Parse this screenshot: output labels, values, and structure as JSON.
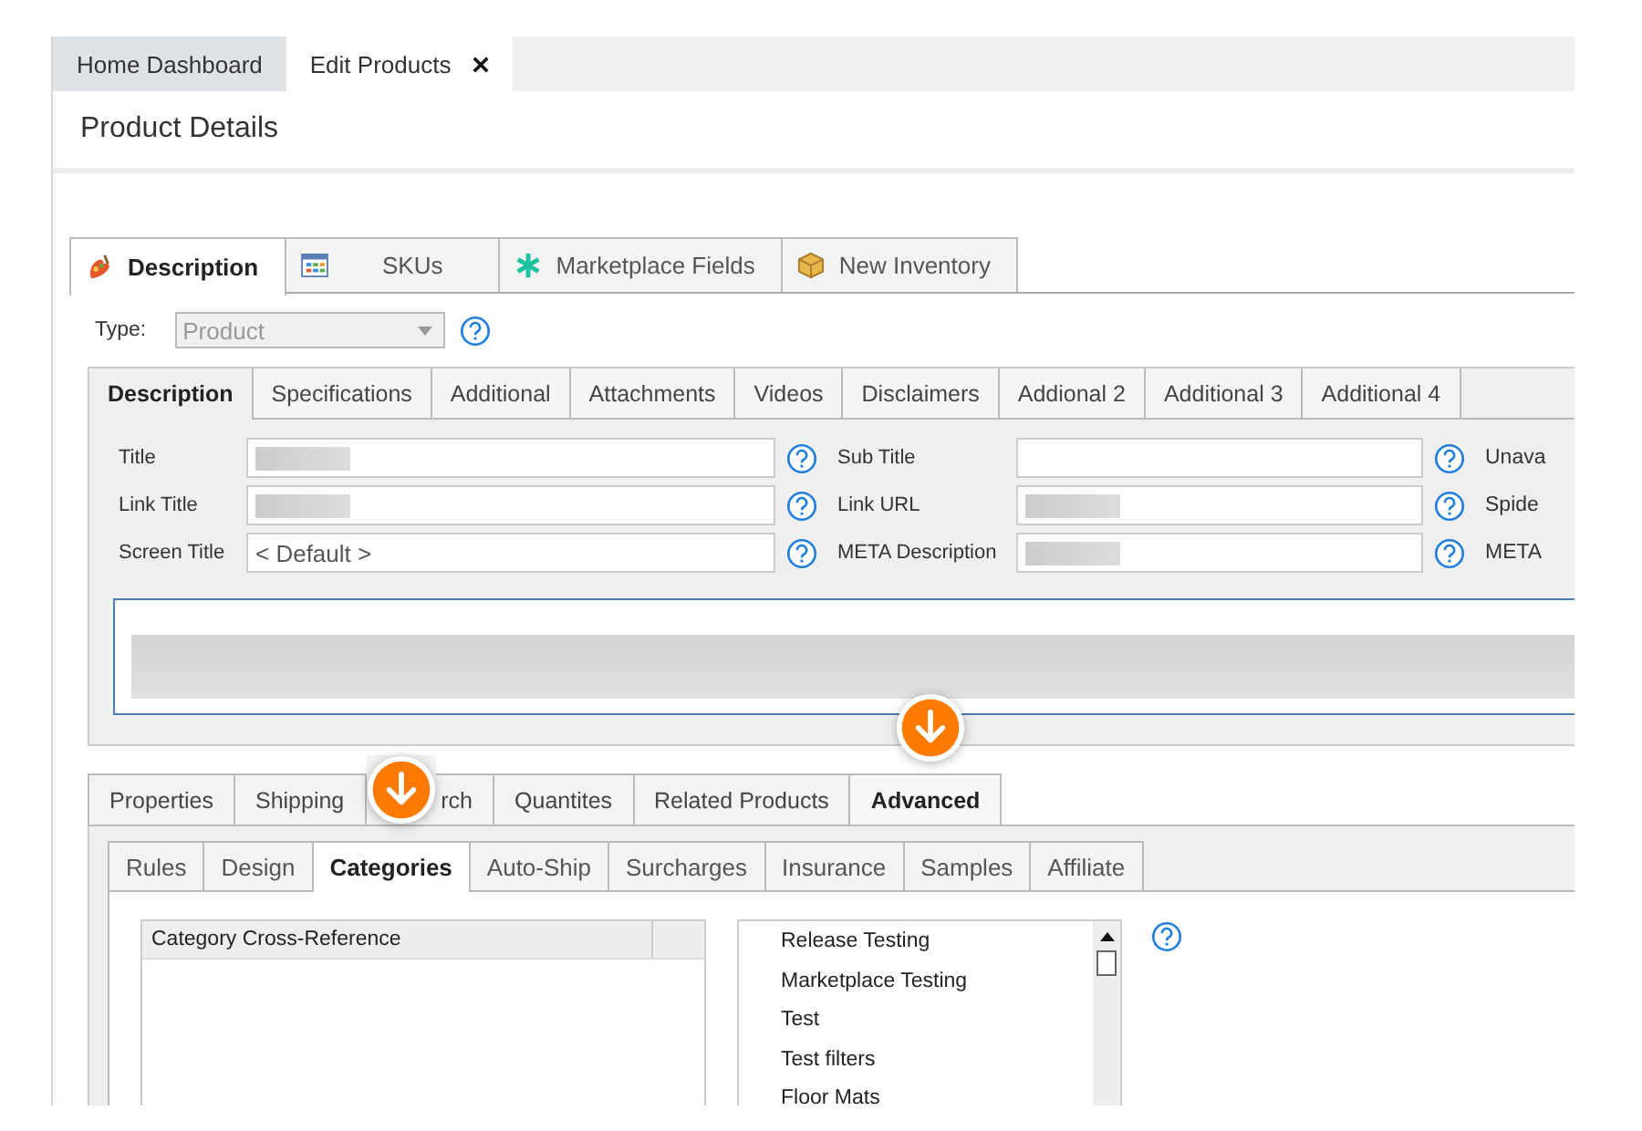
{
  "top_tabs": [
    {
      "label": "Home Dashboard",
      "selected": false,
      "closable": false
    },
    {
      "label": "Edit Products",
      "selected": true,
      "closable": true
    }
  ],
  "page_title": "Product Details",
  "main_tabs": [
    {
      "label": "Description",
      "kind": "paint",
      "selected": true
    },
    {
      "label": "SKUs",
      "kind": "grid",
      "selected": false
    },
    {
      "label": "Marketplace Fields",
      "kind": "asterisk",
      "selected": false
    },
    {
      "label": "New Inventory",
      "kind": "box",
      "selected": false
    }
  ],
  "type_field": {
    "label": "Type:",
    "value": "Product",
    "disabled": true
  },
  "description_tabs": [
    {
      "label": "Description",
      "selected": true
    },
    {
      "label": "Specifications",
      "selected": false
    },
    {
      "label": "Additional",
      "selected": false
    },
    {
      "label": "Attachments",
      "selected": false
    },
    {
      "label": "Videos",
      "selected": false
    },
    {
      "label": "Disclaimers",
      "selected": false
    },
    {
      "label": "Addional 2",
      "selected": false
    },
    {
      "label": "Additional 3",
      "selected": false
    },
    {
      "label": "Additional 4",
      "selected": false
    }
  ],
  "field_rows": [
    {
      "left": {
        "label": "Title",
        "redacted": true
      },
      "right": {
        "label": "Sub Title",
        "redacted": false
      },
      "extra": "Unava"
    },
    {
      "left": {
        "label": "Link Title",
        "redacted": true
      },
      "right": {
        "label": "Link URL",
        "redacted": true
      },
      "extra": "Spide"
    },
    {
      "left": {
        "label": "Screen Title",
        "redacted": false,
        "value": "< Default >"
      },
      "right": {
        "label": "META Description",
        "redacted": true
      },
      "extra": "META"
    }
  ],
  "description_body": {
    "redacted": true
  },
  "section_tabs": [
    {
      "label": "Properties",
      "selected": false,
      "marker": false
    },
    {
      "label": "Shipping",
      "selected": false,
      "marker": false
    },
    {
      "label": "rch",
      "selected": false,
      "marker": true
    },
    {
      "label": "Quantites",
      "selected": false,
      "marker": false
    },
    {
      "label": "Related Products",
      "selected": false,
      "marker": false
    },
    {
      "label": "Advanced",
      "selected": true,
      "marker": false
    }
  ],
  "advanced_tabs": [
    {
      "label": "Rules",
      "selected": false
    },
    {
      "label": "Design",
      "selected": false
    },
    {
      "label": "Categories",
      "selected": true
    },
    {
      "label": "Auto-Ship",
      "selected": false
    },
    {
      "label": "Surcharges",
      "selected": false
    },
    {
      "label": "Insurance",
      "selected": false
    },
    {
      "label": "Samples",
      "selected": false
    },
    {
      "label": "Affiliate",
      "selected": false
    }
  ],
  "cross_reference": {
    "column": "Category Cross-Reference"
  },
  "categories": [
    "Release Testing",
    "Marketplace Testing",
    "Test",
    "Test filters",
    "Floor Mats"
  ]
}
